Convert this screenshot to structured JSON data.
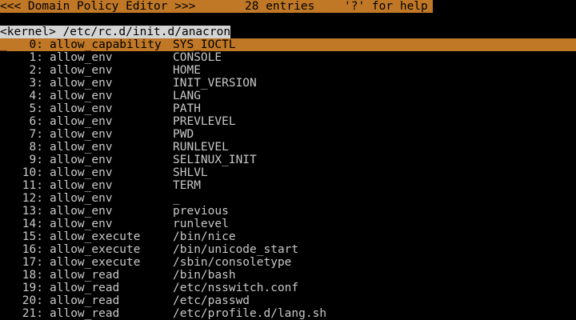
{
  "header": {
    "title": "<<< Domain Policy Editor >>>",
    "entries": "28 entries",
    "help": "'?' for help"
  },
  "domain": "<kernel> /etc/rc.d/init.d/anacron",
  "colors": {
    "header_bg": "#c07826",
    "selected_bg": "#c07826",
    "domain_bg": "#d4d4d4",
    "text": "#c8c8c8",
    "background": "#000000"
  },
  "cursor": "_",
  "selected_index": 0,
  "rows": [
    {
      "num": "0:",
      "directive": "allow_capability",
      "arg": "SYS_IOCTL"
    },
    {
      "num": "1:",
      "directive": "allow_env",
      "arg": "CONSOLE"
    },
    {
      "num": "2:",
      "directive": "allow_env",
      "arg": "HOME"
    },
    {
      "num": "3:",
      "directive": "allow_env",
      "arg": "INIT_VERSION"
    },
    {
      "num": "4:",
      "directive": "allow_env",
      "arg": "LANG"
    },
    {
      "num": "5:",
      "directive": "allow_env",
      "arg": "PATH"
    },
    {
      "num": "6:",
      "directive": "allow_env",
      "arg": "PREVLEVEL"
    },
    {
      "num": "7:",
      "directive": "allow_env",
      "arg": "PWD"
    },
    {
      "num": "8:",
      "directive": "allow_env",
      "arg": "RUNLEVEL"
    },
    {
      "num": "9:",
      "directive": "allow_env",
      "arg": "SELINUX_INIT"
    },
    {
      "num": "10:",
      "directive": "allow_env",
      "arg": "SHLVL"
    },
    {
      "num": "11:",
      "directive": "allow_env",
      "arg": "TERM"
    },
    {
      "num": "12:",
      "directive": "allow_env",
      "arg": "_"
    },
    {
      "num": "13:",
      "directive": "allow_env",
      "arg": "previous"
    },
    {
      "num": "14:",
      "directive": "allow_env",
      "arg": "runlevel"
    },
    {
      "num": "15:",
      "directive": "allow_execute",
      "arg": "/bin/nice"
    },
    {
      "num": "16:",
      "directive": "allow_execute",
      "arg": "/bin/unicode_start"
    },
    {
      "num": "17:",
      "directive": "allow_execute",
      "arg": "/sbin/consoletype"
    },
    {
      "num": "18:",
      "directive": "allow_read",
      "arg": "/bin/bash"
    },
    {
      "num": "19:",
      "directive": "allow_read",
      "arg": "/etc/nsswitch.conf"
    },
    {
      "num": "20:",
      "directive": "allow_read",
      "arg": "/etc/passwd"
    },
    {
      "num": "21:",
      "directive": "allow_read",
      "arg": "/etc/profile.d/lang.sh"
    }
  ]
}
